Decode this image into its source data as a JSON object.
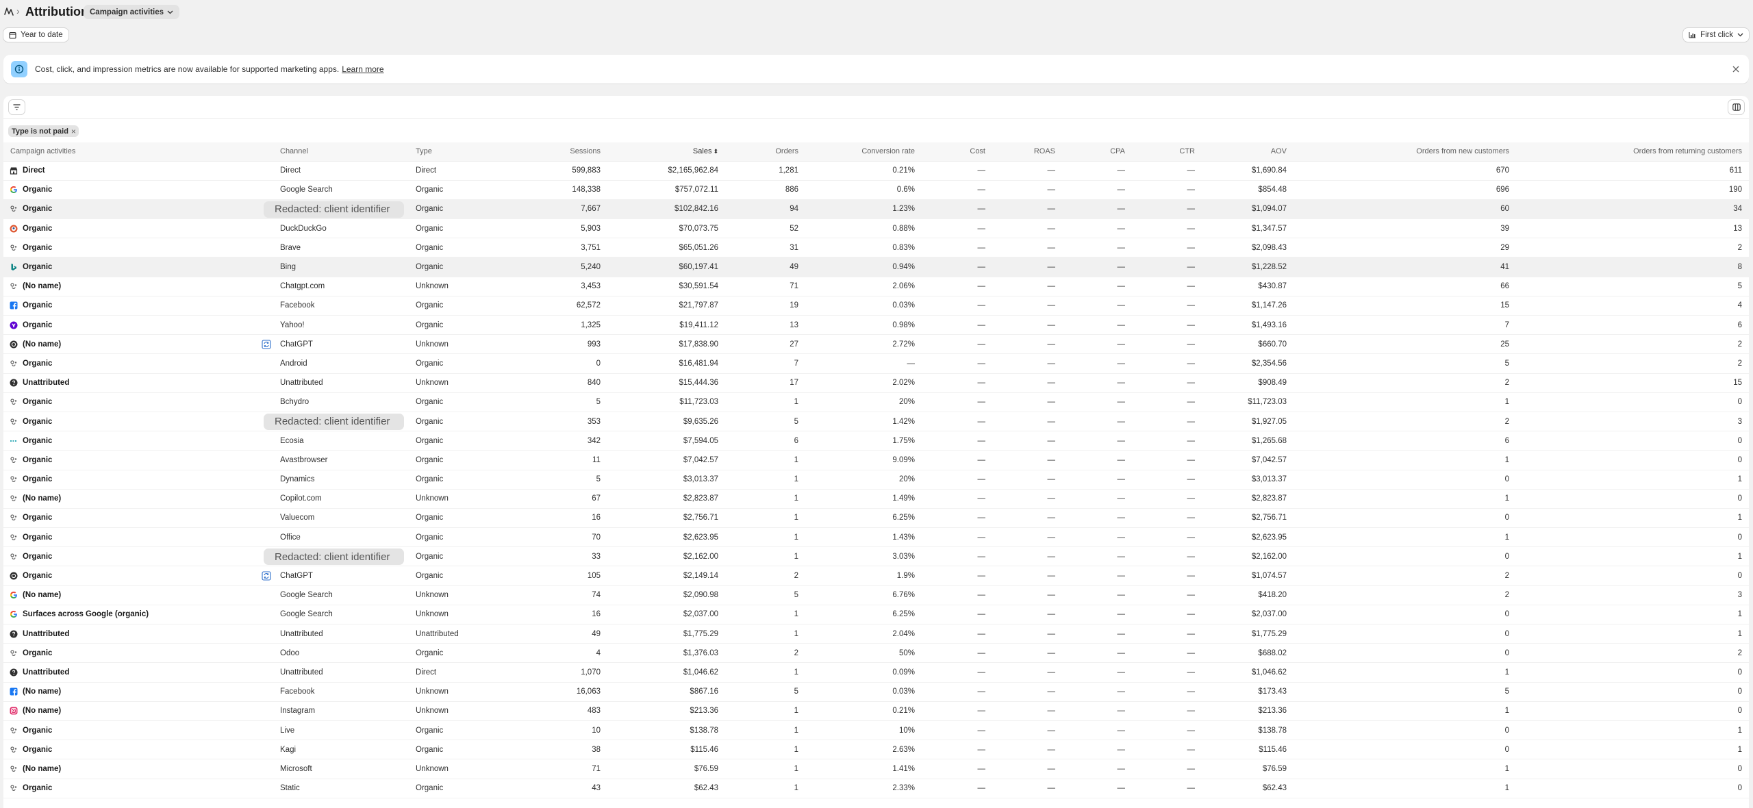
{
  "header": {
    "title": "Attribution",
    "separator": "›",
    "view_select": "Campaign activities",
    "date_range": "Year to date",
    "attribution_model": "First click"
  },
  "banner": {
    "text": "Cost, click, and impression metrics are now available for supported marketing apps.",
    "link": "Learn more"
  },
  "filters": {
    "chip": "Type is not paid"
  },
  "table": {
    "columns": [
      "Campaign activities",
      "Channel",
      "Type",
      "Sessions",
      "Sales",
      "Orders",
      "Conversion rate",
      "Cost",
      "ROAS",
      "CPA",
      "CTR",
      "AOV",
      "Orders from new customers",
      "Orders from returning customers"
    ],
    "redacted_label": "Redacted: client identifier",
    "rows": [
      {
        "icon": "store-icon",
        "activity": "Direct",
        "channel": "Direct",
        "type": "Direct",
        "sessions": "599,883",
        "sales": "$2,165,962.84",
        "orders": "1,281",
        "conv": "0.21%",
        "cost": "—",
        "roas": "—",
        "cpa": "—",
        "ctr": "—",
        "aov": "$1,690.84",
        "new": "670",
        "ret": "611"
      },
      {
        "icon": "google-icon",
        "activity": "Organic",
        "channel": "Google Search",
        "type": "Organic",
        "sessions": "148,338",
        "sales": "$757,072.11",
        "orders": "886",
        "conv": "0.6%",
        "cost": "—",
        "roas": "—",
        "cpa": "—",
        "ctr": "—",
        "aov": "$854.48",
        "new": "696",
        "ret": "190"
      },
      {
        "icon": "generic-source-icon",
        "activity": "Organic",
        "channel": "",
        "redacted": true,
        "type": "Organic",
        "sessions": "7,667",
        "sales": "$102,842.16",
        "orders": "94",
        "conv": "1.23%",
        "cost": "—",
        "roas": "—",
        "cpa": "—",
        "ctr": "—",
        "aov": "$1,094.07",
        "new": "60",
        "ret": "34",
        "highlight": true
      },
      {
        "icon": "duckduckgo-icon",
        "activity": "Organic",
        "channel": "DuckDuckGo",
        "type": "Organic",
        "sessions": "5,903",
        "sales": "$70,073.75",
        "orders": "52",
        "conv": "0.88%",
        "cost": "—",
        "roas": "—",
        "cpa": "—",
        "ctr": "—",
        "aov": "$1,347.57",
        "new": "39",
        "ret": "13"
      },
      {
        "icon": "generic-source-icon",
        "activity": "Organic",
        "channel": "Brave",
        "type": "Organic",
        "sessions": "3,751",
        "sales": "$65,051.26",
        "orders": "31",
        "conv": "0.83%",
        "cost": "—",
        "roas": "—",
        "cpa": "—",
        "ctr": "—",
        "aov": "$2,098.43",
        "new": "29",
        "ret": "2"
      },
      {
        "icon": "bing-icon",
        "activity": "Organic",
        "channel": "Bing",
        "type": "Organic",
        "sessions": "5,240",
        "sales": "$60,197.41",
        "orders": "49",
        "conv": "0.94%",
        "cost": "—",
        "roas": "—",
        "cpa": "—",
        "ctr": "—",
        "aov": "$1,228.52",
        "new": "41",
        "ret": "8",
        "highlight": true
      },
      {
        "icon": "generic-source-icon",
        "activity": "(No name)",
        "channel": "Chatgpt.com",
        "type": "Unknown",
        "sessions": "3,453",
        "sales": "$30,591.54",
        "orders": "71",
        "conv": "2.06%",
        "cost": "—",
        "roas": "—",
        "cpa": "—",
        "ctr": "—",
        "aov": "$430.87",
        "new": "66",
        "ret": "5"
      },
      {
        "icon": "facebook-icon",
        "activity": "Organic",
        "channel": "Facebook",
        "type": "Organic",
        "sessions": "62,572",
        "sales": "$21,797.87",
        "orders": "19",
        "conv": "0.03%",
        "cost": "—",
        "roas": "—",
        "cpa": "—",
        "ctr": "—",
        "aov": "$1,147.26",
        "new": "15",
        "ret": "4"
      },
      {
        "icon": "yahoo-icon",
        "activity": "Organic",
        "channel": "Yahoo!",
        "type": "Organic",
        "sessions": "1,325",
        "sales": "$19,411.12",
        "orders": "13",
        "conv": "0.98%",
        "cost": "—",
        "roas": "—",
        "cpa": "—",
        "ctr": "—",
        "aov": "$1,493.16",
        "new": "7",
        "ret": "6"
      },
      {
        "icon": "chatgpt-icon",
        "activity": "(No name)",
        "sync": true,
        "channel": "ChatGPT",
        "type": "Unknown",
        "sessions": "993",
        "sales": "$17,838.90",
        "orders": "27",
        "conv": "2.72%",
        "cost": "—",
        "roas": "—",
        "cpa": "—",
        "ctr": "—",
        "aov": "$660.70",
        "new": "25",
        "ret": "2"
      },
      {
        "icon": "generic-source-icon",
        "activity": "Organic",
        "channel": "Android",
        "type": "Organic",
        "sessions": "0",
        "sales": "$16,481.94",
        "orders": "7",
        "conv": "—",
        "cost": "—",
        "roas": "—",
        "cpa": "—",
        "ctr": "—",
        "aov": "$2,354.56",
        "new": "5",
        "ret": "2"
      },
      {
        "icon": "question-icon",
        "activity": "Unattributed",
        "channel": "Unattributed",
        "type": "Unknown",
        "sessions": "840",
        "sales": "$15,444.36",
        "orders": "17",
        "conv": "2.02%",
        "cost": "—",
        "roas": "—",
        "cpa": "—",
        "ctr": "—",
        "aov": "$908.49",
        "new": "2",
        "ret": "15"
      },
      {
        "icon": "generic-source-icon",
        "activity": "Organic",
        "channel": "Bchydro",
        "type": "Organic",
        "sessions": "5",
        "sales": "$11,723.03",
        "orders": "1",
        "conv": "20%",
        "cost": "—",
        "roas": "—",
        "cpa": "—",
        "ctr": "—",
        "aov": "$11,723.03",
        "new": "1",
        "ret": "0"
      },
      {
        "icon": "generic-source-icon",
        "activity": "Organic",
        "channel": "",
        "redacted": true,
        "type": "Organic",
        "sessions": "353",
        "sales": "$9,635.26",
        "orders": "5",
        "conv": "1.42%",
        "cost": "—",
        "roas": "—",
        "cpa": "—",
        "ctr": "—",
        "aov": "$1,927.05",
        "new": "2",
        "ret": "3"
      },
      {
        "icon": "ecosia-icon",
        "activity": "Organic",
        "channel": "Ecosia",
        "type": "Organic",
        "sessions": "342",
        "sales": "$7,594.05",
        "orders": "6",
        "conv": "1.75%",
        "cost": "—",
        "roas": "—",
        "cpa": "—",
        "ctr": "—",
        "aov": "$1,265.68",
        "new": "6",
        "ret": "0"
      },
      {
        "icon": "generic-source-icon",
        "activity": "Organic",
        "channel": "Avastbrowser",
        "type": "Organic",
        "sessions": "11",
        "sales": "$7,042.57",
        "orders": "1",
        "conv": "9.09%",
        "cost": "—",
        "roas": "—",
        "cpa": "—",
        "ctr": "—",
        "aov": "$7,042.57",
        "new": "1",
        "ret": "0"
      },
      {
        "icon": "generic-source-icon",
        "activity": "Organic",
        "channel": "Dynamics",
        "type": "Organic",
        "sessions": "5",
        "sales": "$3,013.37",
        "orders": "1",
        "conv": "20%",
        "cost": "—",
        "roas": "—",
        "cpa": "—",
        "ctr": "—",
        "aov": "$3,013.37",
        "new": "0",
        "ret": "1"
      },
      {
        "icon": "generic-source-icon",
        "activity": "(No name)",
        "channel": "Copilot.com",
        "type": "Unknown",
        "sessions": "67",
        "sales": "$2,823.87",
        "orders": "1",
        "conv": "1.49%",
        "cost": "—",
        "roas": "—",
        "cpa": "—",
        "ctr": "—",
        "aov": "$2,823.87",
        "new": "1",
        "ret": "0"
      },
      {
        "icon": "generic-source-icon",
        "activity": "Organic",
        "channel": "Valuecom",
        "type": "Organic",
        "sessions": "16",
        "sales": "$2,756.71",
        "orders": "1",
        "conv": "6.25%",
        "cost": "—",
        "roas": "—",
        "cpa": "—",
        "ctr": "—",
        "aov": "$2,756.71",
        "new": "0",
        "ret": "1"
      },
      {
        "icon": "generic-source-icon",
        "activity": "Organic",
        "channel": "Office",
        "type": "Organic",
        "sessions": "70",
        "sales": "$2,623.95",
        "orders": "1",
        "conv": "1.43%",
        "cost": "—",
        "roas": "—",
        "cpa": "—",
        "ctr": "—",
        "aov": "$2,623.95",
        "new": "1",
        "ret": "0"
      },
      {
        "icon": "generic-source-icon",
        "activity": "Organic",
        "channel": "",
        "redacted": true,
        "type": "Organic",
        "sessions": "33",
        "sales": "$2,162.00",
        "orders": "1",
        "conv": "3.03%",
        "cost": "—",
        "roas": "—",
        "cpa": "—",
        "ctr": "—",
        "aov": "$2,162.00",
        "new": "0",
        "ret": "1"
      },
      {
        "icon": "chatgpt-icon",
        "activity": "Organic",
        "sync": true,
        "channel": "ChatGPT",
        "type": "Organic",
        "sessions": "105",
        "sales": "$2,149.14",
        "orders": "2",
        "conv": "1.9%",
        "cost": "—",
        "roas": "—",
        "cpa": "—",
        "ctr": "—",
        "aov": "$1,074.57",
        "new": "2",
        "ret": "0"
      },
      {
        "icon": "google-icon",
        "activity": "(No name)",
        "channel": "Google Search",
        "type": "Unknown",
        "sessions": "74",
        "sales": "$2,090.98",
        "orders": "5",
        "conv": "6.76%",
        "cost": "—",
        "roas": "—",
        "cpa": "—",
        "ctr": "—",
        "aov": "$418.20",
        "new": "2",
        "ret": "3"
      },
      {
        "icon": "google-icon",
        "activity": "Surfaces across Google (organic)",
        "channel": "Google Search",
        "type": "Unknown",
        "sessions": "16",
        "sales": "$2,037.00",
        "orders": "1",
        "conv": "6.25%",
        "cost": "—",
        "roas": "—",
        "cpa": "—",
        "ctr": "—",
        "aov": "$2,037.00",
        "new": "0",
        "ret": "1"
      },
      {
        "icon": "question-icon",
        "activity": "Unattributed",
        "channel": "Unattributed",
        "type": "Unattributed",
        "sessions": "49",
        "sales": "$1,775.29",
        "orders": "1",
        "conv": "2.04%",
        "cost": "—",
        "roas": "—",
        "cpa": "—",
        "ctr": "—",
        "aov": "$1,775.29",
        "new": "0",
        "ret": "1"
      },
      {
        "icon": "generic-source-icon",
        "activity": "Organic",
        "channel": "Odoo",
        "type": "Organic",
        "sessions": "4",
        "sales": "$1,376.03",
        "orders": "2",
        "conv": "50%",
        "cost": "—",
        "roas": "—",
        "cpa": "—",
        "ctr": "—",
        "aov": "$688.02",
        "new": "0",
        "ret": "2"
      },
      {
        "icon": "question-icon",
        "activity": "Unattributed",
        "channel": "Unattributed",
        "type": "Direct",
        "sessions": "1,070",
        "sales": "$1,046.62",
        "orders": "1",
        "conv": "0.09%",
        "cost": "—",
        "roas": "—",
        "cpa": "—",
        "ctr": "—",
        "aov": "$1,046.62",
        "new": "1",
        "ret": "0"
      },
      {
        "icon": "facebook-icon",
        "activity": "(No name)",
        "channel": "Facebook",
        "type": "Unknown",
        "sessions": "16,063",
        "sales": "$867.16",
        "orders": "5",
        "conv": "0.03%",
        "cost": "—",
        "roas": "—",
        "cpa": "—",
        "ctr": "—",
        "aov": "$173.43",
        "new": "5",
        "ret": "0"
      },
      {
        "icon": "instagram-icon",
        "activity": "(No name)",
        "channel": "Instagram",
        "type": "Unknown",
        "sessions": "483",
        "sales": "$213.36",
        "orders": "1",
        "conv": "0.21%",
        "cost": "—",
        "roas": "—",
        "cpa": "—",
        "ctr": "—",
        "aov": "$213.36",
        "new": "1",
        "ret": "0"
      },
      {
        "icon": "generic-source-icon",
        "activity": "Organic",
        "channel": "Live",
        "type": "Organic",
        "sessions": "10",
        "sales": "$138.78",
        "orders": "1",
        "conv": "10%",
        "cost": "—",
        "roas": "—",
        "cpa": "—",
        "ctr": "—",
        "aov": "$138.78",
        "new": "0",
        "ret": "1"
      },
      {
        "icon": "generic-source-icon",
        "activity": "Organic",
        "channel": "Kagi",
        "type": "Organic",
        "sessions": "38",
        "sales": "$115.46",
        "orders": "1",
        "conv": "2.63%",
        "cost": "—",
        "roas": "—",
        "cpa": "—",
        "ctr": "—",
        "aov": "$115.46",
        "new": "0",
        "ret": "1"
      },
      {
        "icon": "generic-source-icon",
        "activity": "(No name)",
        "channel": "Microsoft",
        "type": "Unknown",
        "sessions": "71",
        "sales": "$76.59",
        "orders": "1",
        "conv": "1.41%",
        "cost": "—",
        "roas": "—",
        "cpa": "—",
        "ctr": "—",
        "aov": "$76.59",
        "new": "1",
        "ret": "0"
      },
      {
        "icon": "generic-source-icon",
        "activity": "Organic",
        "channel": "Static",
        "type": "Organic",
        "sessions": "43",
        "sales": "$62.43",
        "orders": "1",
        "conv": "2.33%",
        "cost": "—",
        "roas": "—",
        "cpa": "—",
        "ctr": "—",
        "aov": "$62.43",
        "new": "1",
        "ret": "0"
      }
    ]
  },
  "colors": {
    "banner_icon_bg": "#91d0ff",
    "page_bg": "#f1f1f1",
    "sync_icon": "#2c6ecb"
  }
}
